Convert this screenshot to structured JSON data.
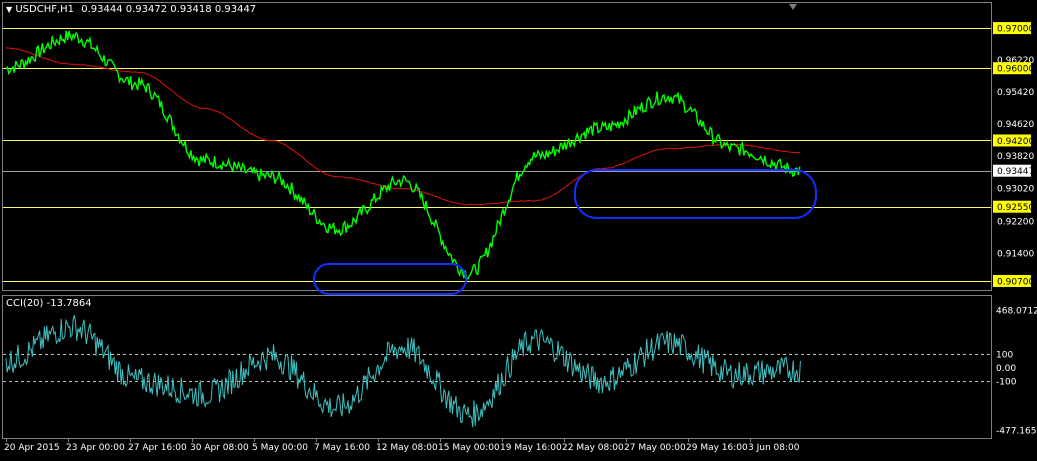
{
  "header": {
    "symbol": "USDCHF,H1",
    "ohlc": "0.93444 0.93472 0.93418 0.93447"
  },
  "indicator": {
    "label": "CCI(20) -13.7864"
  },
  "colors": {
    "background": "#000000",
    "price_line": "#00ff00",
    "moving_average": "#e01010",
    "cci_line": "#40c0c0",
    "hline": "#ffff66",
    "highlight_label_bg": "#ffff00",
    "current_label_bg": "#ffffff",
    "ellipse": "#1030ff",
    "axis_text": "#ffffff"
  },
  "chart_data": [
    {
      "type": "line",
      "title": "USDCHF,H1",
      "x": [
        "20 Apr 2015",
        "23 Apr 00:00",
        "27 Apr 16:00",
        "30 Apr 08:00",
        "5 May 00:00",
        "7 May 16:00",
        "12 May 08:00",
        "15 May 00:00",
        "19 May 16:00",
        "22 May 08:00",
        "27 May 00:00",
        "29 May 16:00",
        "3 Jun 08:00"
      ],
      "series": [
        {
          "name": "",
          "values": [
            0.96,
            0.968,
            0.956,
            0.937,
            0.933,
            0.92,
            0.932,
            0.909,
            0.938,
            0.945,
            0.953,
            0.94,
            0.9345
          ]
        },
        {
          "name": "",
          "values": [
            0.965,
            0.961,
            0.959,
            0.95,
            0.942,
            0.933,
            0.93,
            0.926,
            0.927,
            0.935,
            0.94,
            0.941,
            0.939
          ]
        }
      ],
      "y_ticks": [
        "0.97000",
        "0.96220",
        "0.96000",
        "0.95420",
        "0.94620",
        "0.94200",
        "0.93820",
        "0.93447",
        "0.93020",
        "0.92550",
        "0.92200",
        "0.91400",
        "0.90700"
      ],
      "highlighted_levels": [
        "0.97000",
        "0.96000",
        "0.94200",
        "0.92550",
        "0.90700"
      ],
      "current_price": "0.93447",
      "ylim": [
        0.9055,
        0.975
      ],
      "grid": false
    },
    {
      "type": "line",
      "title": "CCI(20) -13.7864",
      "x": [
        "20 Apr 2015",
        "23 Apr 00:00",
        "27 Apr 16:00",
        "30 Apr 08:00",
        "5 May 00:00",
        "7 May 16:00",
        "12 May 08:00",
        "15 May 00:00",
        "19 May 16:00",
        "22 May 08:00",
        "27 May 00:00",
        "29 May 16:00",
        "3 Jun 08:00"
      ],
      "series": [
        {
          "name": "",
          "values": [
            50,
            300,
            -100,
            -200,
            80,
            -300,
            150,
            -350,
            200,
            -100,
            180,
            -50,
            -13.7864
          ]
        }
      ],
      "y_ticks": [
        "468.0712",
        "100",
        "0.00",
        "-100",
        "-477.1659"
      ],
      "levels": [
        100,
        -100
      ],
      "ylim": [
        -477.1659,
        468.0712
      ],
      "grid": false
    }
  ]
}
